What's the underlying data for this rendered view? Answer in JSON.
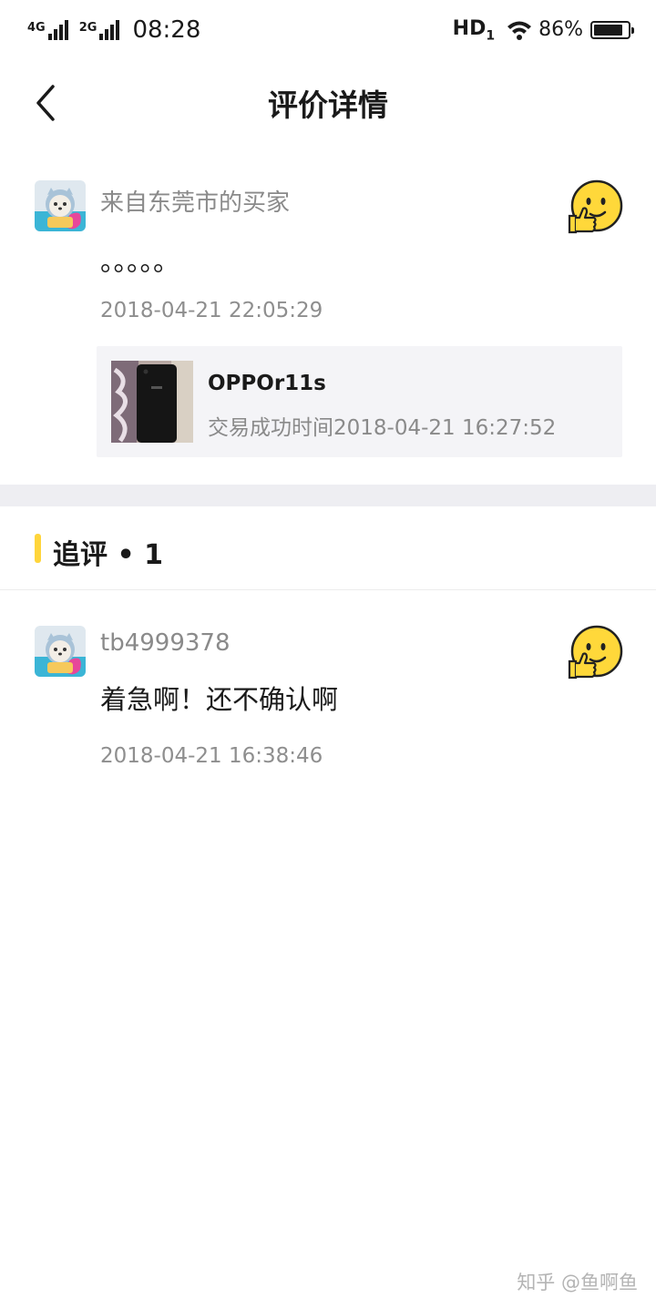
{
  "status_bar": {
    "sim1": "4G",
    "sim2": "2G",
    "time": "08:28",
    "hd": "HD",
    "hd_sub": "1",
    "battery_pct": "86%",
    "battery_level": 0.86
  },
  "nav": {
    "title": "评价详情"
  },
  "review": {
    "user": "来自东莞市的买家",
    "text": "。。。。。",
    "time": "2018-04-21 22:05:29",
    "product": {
      "name": "OPPOr11s",
      "meta": "交易成功时间2018-04-21 16:27:52"
    }
  },
  "followup": {
    "title": "追评 • 1",
    "review": {
      "user": "tb4999378",
      "text": "着急啊！还不确认啊",
      "time": "2018-04-21 16:38:46"
    }
  },
  "watermark": "知乎 @鱼啊鱼",
  "colors": {
    "accent": "#ffd53b",
    "emoji": "#ffd83a",
    "band": "#eeeef2"
  }
}
